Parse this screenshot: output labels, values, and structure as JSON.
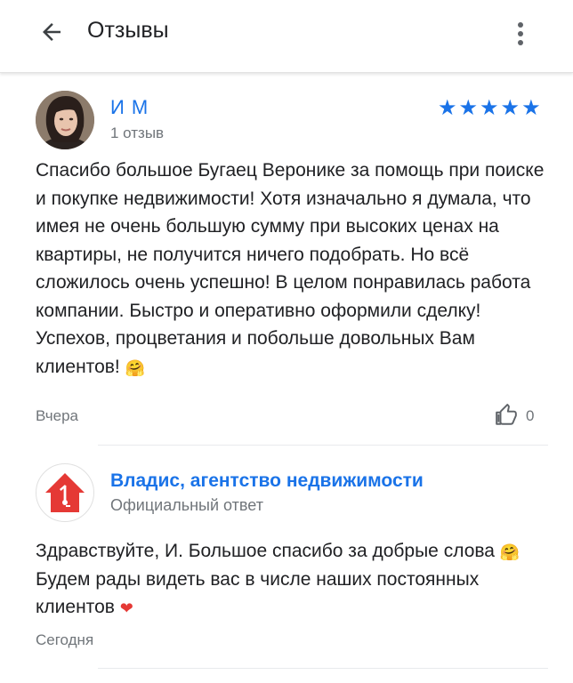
{
  "header": {
    "title": "Отзывы",
    "back_icon": "arrow-back-icon",
    "more_icon": "more-vert-icon"
  },
  "review": {
    "author": "И М",
    "reviews_count": "1 отзыв",
    "rating": 5,
    "rating_max": 5,
    "star_color": "#1a73e8",
    "text": "Спасибо большое Бугаец Веронике за помощь при поиске и покупке недвижимости! Хотя изначально я думала, что имея не очень большую сумму при высоких ценах на квартиры, не получится ничего подобрать. Но всё сложилось очень успешно! В целом понравилась работа компании. Быстро и оперативно оформили сделку! Успехов, процветания и побольше довольных Вам клиентов!",
    "emoji": "🤗",
    "date": "Вчера",
    "likes": "0"
  },
  "reply": {
    "business_name": "Владис, агентство недвижимости",
    "label": "Официальный ответ",
    "logo_number": "1",
    "logo_color": "#e53935",
    "text_part1": "Здравствуйте, И. Большое спасибо за добрые слова",
    "emoji1": "🤗",
    "text_part2": "Будем рады видеть вас в числе наших постоянных клиентов",
    "emoji2": "❤",
    "date": "Сегодня"
  },
  "colors": {
    "accent": "#1a73e8",
    "secondary_text": "#70757a",
    "primary_text": "#202124"
  }
}
